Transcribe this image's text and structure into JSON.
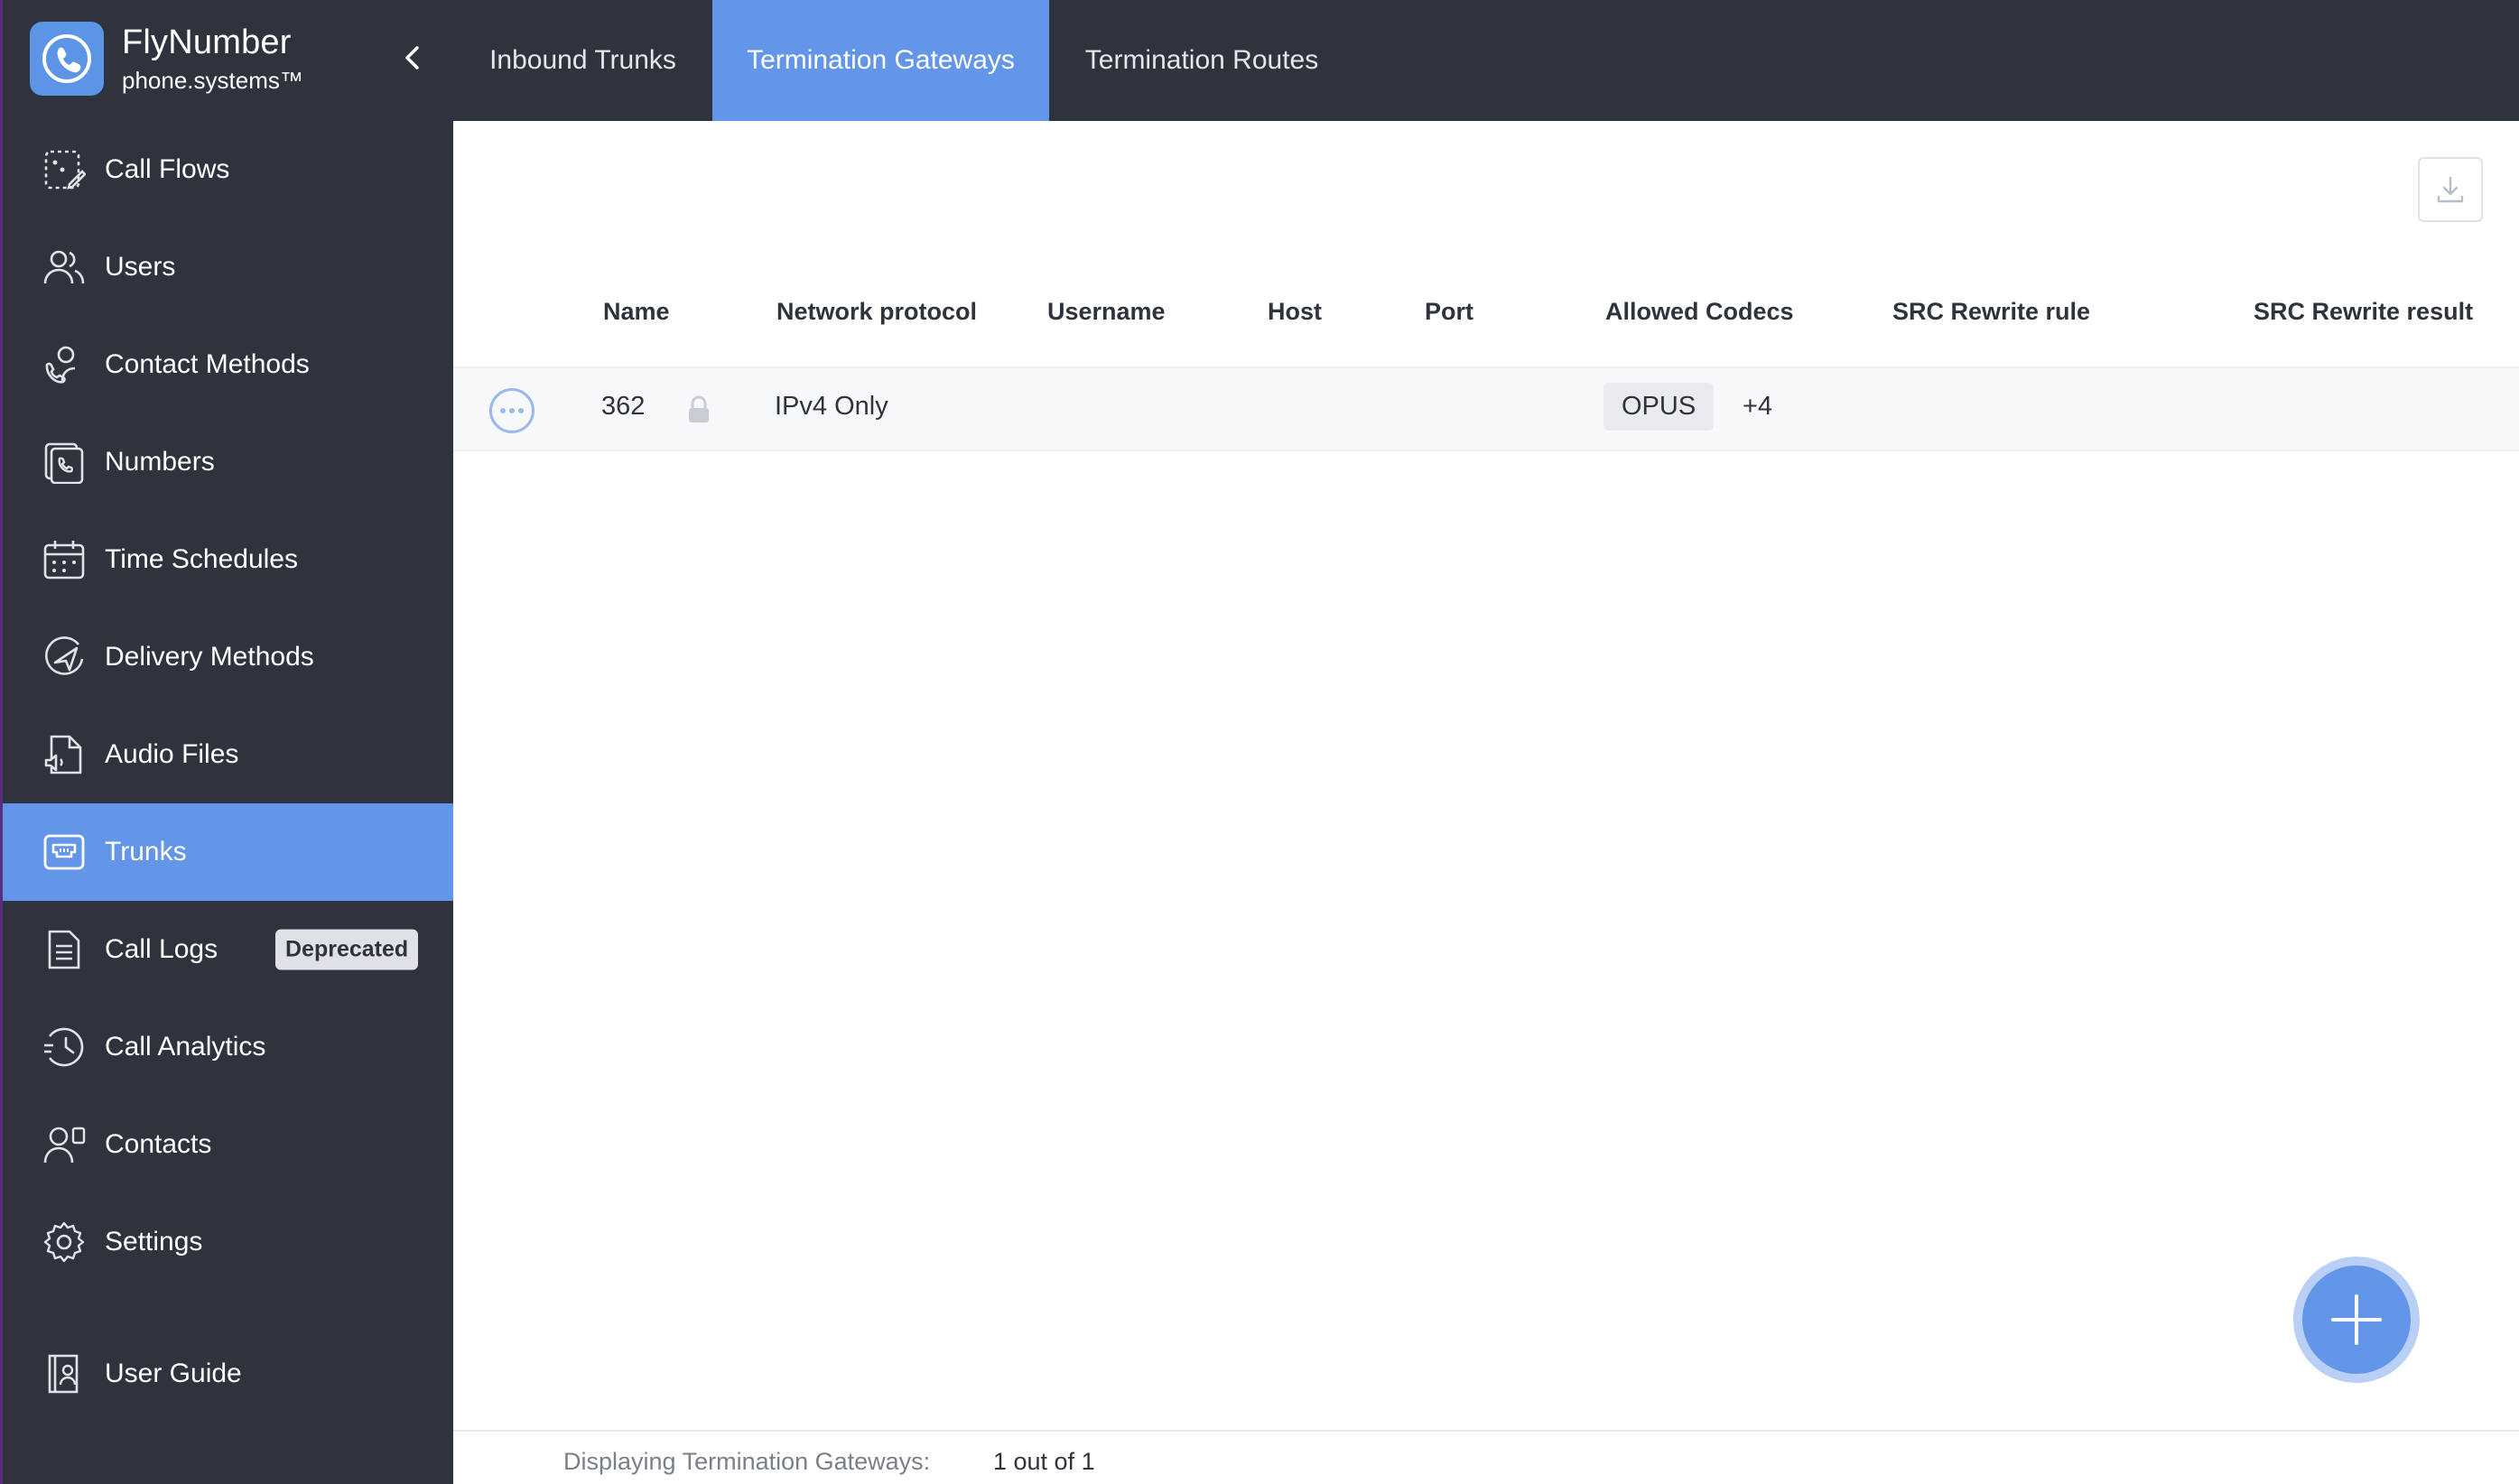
{
  "brand": {
    "name": "FlyNumber",
    "subtitle": "phone.systems™"
  },
  "sidebar": {
    "items": [
      {
        "label": "Call Flows",
        "icon": "call-flows-icon"
      },
      {
        "label": "Users",
        "icon": "users-icon"
      },
      {
        "label": "Contact Methods",
        "icon": "contact-methods-icon"
      },
      {
        "label": "Numbers",
        "icon": "numbers-icon"
      },
      {
        "label": "Time Schedules",
        "icon": "calendar-icon"
      },
      {
        "label": "Delivery Methods",
        "icon": "delivery-icon"
      },
      {
        "label": "Audio Files",
        "icon": "audio-file-icon"
      },
      {
        "label": "Trunks",
        "icon": "trunk-icon",
        "active": true
      },
      {
        "label": "Call Logs",
        "icon": "call-logs-icon",
        "badge": "Deprecated"
      },
      {
        "label": "Call Analytics",
        "icon": "analytics-icon"
      },
      {
        "label": "Contacts",
        "icon": "contacts-icon"
      },
      {
        "label": "Settings",
        "icon": "gear-icon"
      },
      {
        "label": "User Guide",
        "icon": "user-guide-icon"
      }
    ]
  },
  "tabs": [
    {
      "label": "Inbound Trunks"
    },
    {
      "label": "Termination Gateways",
      "active": true
    },
    {
      "label": "Termination Routes"
    }
  ],
  "table": {
    "columns": [
      "Name",
      "Network protocol",
      "Username",
      "Host",
      "Port",
      "Allowed Codecs",
      "SRC Rewrite rule",
      "SRC Rewrite result"
    ],
    "rows": [
      {
        "name": "362",
        "network_protocol": "IPv4 Only",
        "username": "",
        "host": "",
        "port": "",
        "codec": "OPUS",
        "codec_more": "+4",
        "src_rewrite_rule": "",
        "src_rewrite_result": ""
      }
    ]
  },
  "footer": {
    "label": "Displaying Termination Gateways:",
    "count": "1 out of 1"
  },
  "colors": {
    "sidebar_bg": "#2f333d",
    "accent": "#6396e8",
    "badge_bg": "#dfe1e6"
  }
}
